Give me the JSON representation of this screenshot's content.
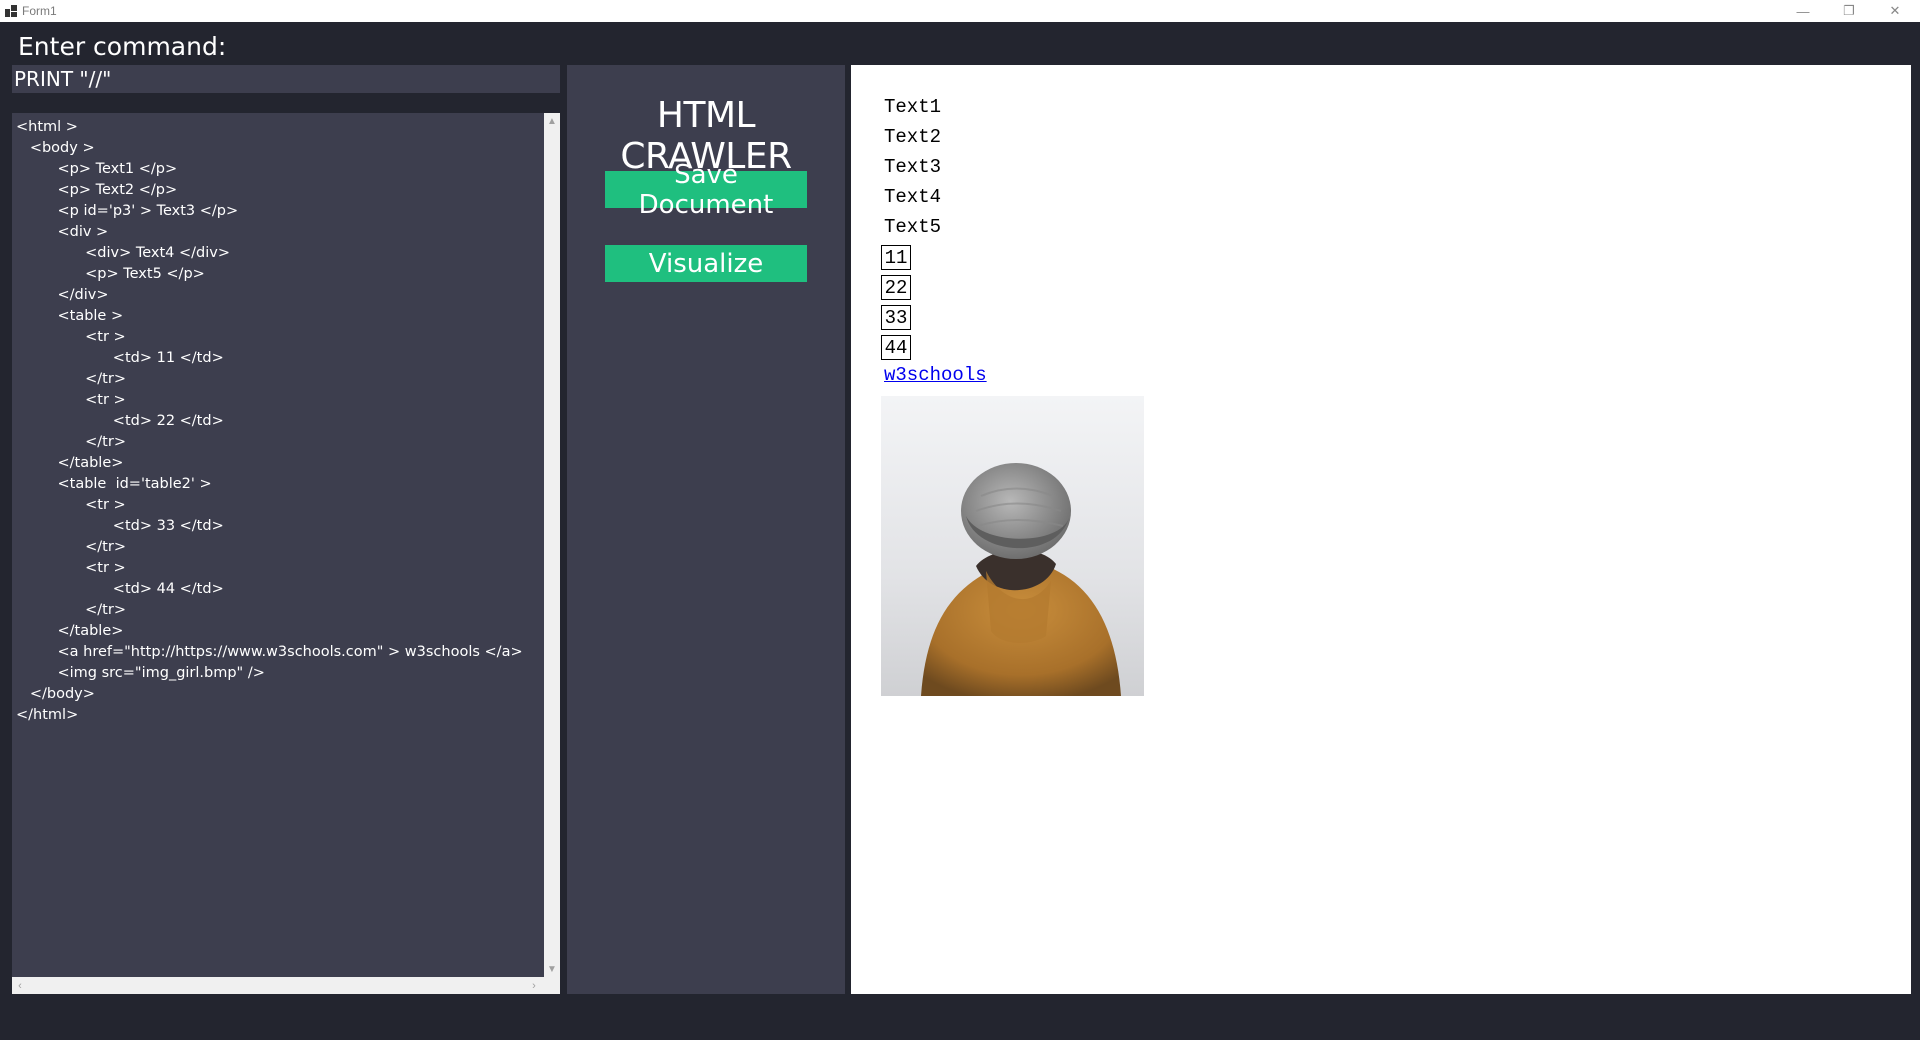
{
  "window": {
    "title": "Form1",
    "minimize_glyph": "—",
    "maximize_glyph": "❐",
    "close_glyph": "✕"
  },
  "command": {
    "label": "Enter command:",
    "value": "PRINT \"//\""
  },
  "code": {
    "lines": [
      "<html >",
      "   <body >",
      "         <p> Text1 </p>",
      "         <p> Text2 </p>",
      "         <p id='p3' > Text3 </p>",
      "         <div >",
      "               <div> Text4 </div>",
      "               <p> Text5 </p>",
      "         </div>",
      "         <table >",
      "               <tr >",
      "                     <td> 11 </td>",
      "               </tr>",
      "               <tr >",
      "                     <td> 22 </td>",
      "               </tr>",
      "         </table>",
      "         <table  id='table2' >",
      "               <tr >",
      "                     <td> 33 </td>",
      "               </tr>",
      "               <tr >",
      "                     <td> 44 </td>",
      "               </tr>",
      "         </table>",
      "         <a href=\"http://https://www.w3schools.com\" > w3schools </a>",
      "         <img src=\"img_girl.bmp\" />",
      "   </body>",
      "</html>"
    ]
  },
  "sidebar": {
    "title": "HTML CRAWLER",
    "save_label": "Save Document",
    "visualize_label": "Visualize"
  },
  "preview": {
    "paragraphs": [
      "Text1",
      "Text2",
      "Text3",
      "Text4",
      "Text5"
    ],
    "cells": [
      "11",
      "22",
      "33",
      "44"
    ],
    "link_text": "w3schools"
  },
  "colors": {
    "background": "#23252f",
    "panel": "#3d3e4e",
    "accent": "#1fbf7f"
  }
}
